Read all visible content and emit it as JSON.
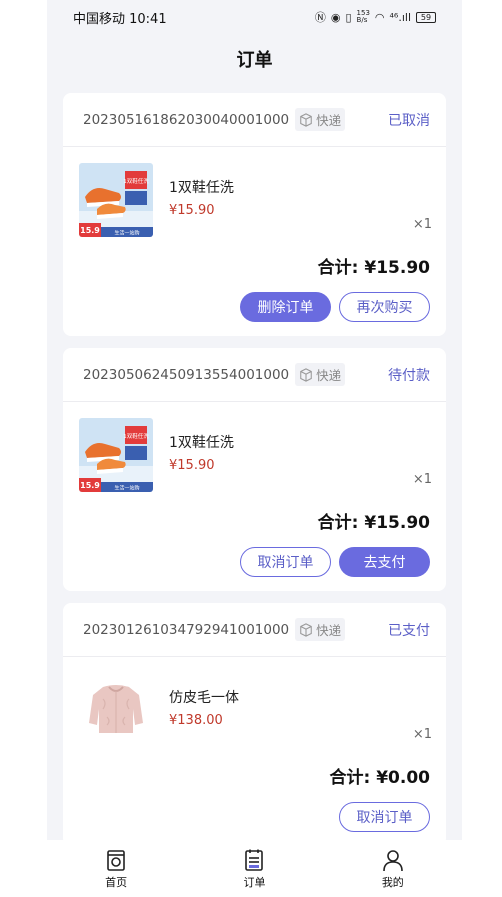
{
  "status_bar": {
    "carrier_time": "中国移动 10:41",
    "net_speed": "153\nB/s",
    "signal": "⁴⁶.ıll",
    "battery": "59"
  },
  "header": {
    "title": "订单"
  },
  "orders": [
    {
      "order_no": "20230516186203004000100​0",
      "shipping": "快递",
      "status": "已取消",
      "product_name": "1双鞋任洗",
      "price": "¥15.90",
      "qty": "×1",
      "total_label": "合计:",
      "total_value": "¥15.90",
      "actions": [
        "删除订单",
        "再次购买"
      ]
    },
    {
      "order_no": "2023050624509135540010​00",
      "shipping": "快递",
      "status": "待付款",
      "product_name": "1双鞋任洗",
      "price": "¥15.90",
      "qty": "×1",
      "total_label": "合计:",
      "total_value": "¥15.90",
      "actions": [
        "取消订单",
        "去支付"
      ]
    },
    {
      "order_no": "2023012610347929410010​00",
      "shipping": "快递",
      "status": "已支付",
      "product_name": "仿皮毛一体",
      "price": "¥138.00",
      "qty": "×1",
      "total_label": "合计:",
      "total_value": "¥0.00",
      "actions": [
        "取消订单"
      ]
    }
  ],
  "shoe_image": {
    "badge_top": "1双鞋任洗",
    "badge_price": "15.9",
    "badge_bottom": "生活一站购"
  },
  "tabbar": [
    {
      "label": "首页",
      "icon": "home-icon"
    },
    {
      "label": "订单",
      "icon": "orders-icon"
    },
    {
      "label": "我的",
      "icon": "profile-icon"
    }
  ],
  "colors": {
    "accent": "#6a6bdf",
    "price": "#c0392b",
    "background": "#f3f4f8"
  }
}
